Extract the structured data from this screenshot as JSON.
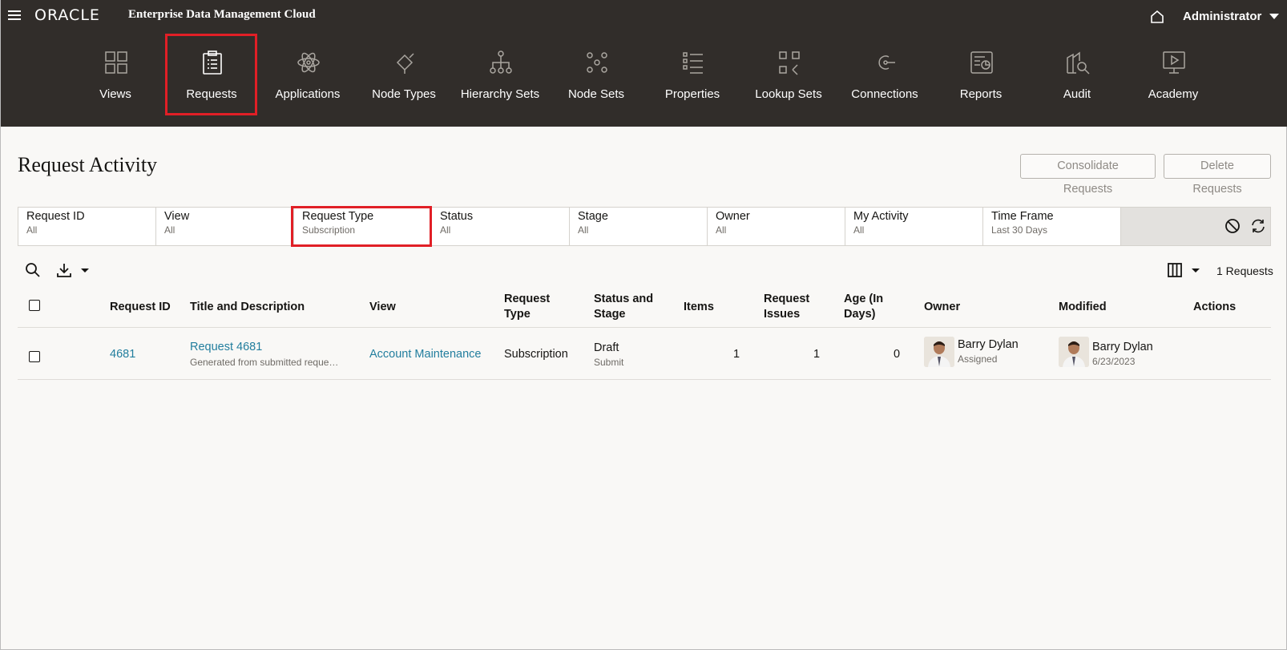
{
  "header": {
    "brand": "ORACLE",
    "app_title": "Enterprise Data Management Cloud",
    "user": "Administrator"
  },
  "nav": [
    {
      "label": "Views",
      "icon": "views-icon"
    },
    {
      "label": "Requests",
      "icon": "clipboard-icon"
    },
    {
      "label": "Applications",
      "icon": "atom-icon"
    },
    {
      "label": "Node Types",
      "icon": "node-type-icon"
    },
    {
      "label": "Hierarchy Sets",
      "icon": "hierarchy-icon"
    },
    {
      "label": "Node Sets",
      "icon": "node-sets-icon"
    },
    {
      "label": "Properties",
      "icon": "list-icon"
    },
    {
      "label": "Lookup Sets",
      "icon": "lookup-icon"
    },
    {
      "label": "Connections",
      "icon": "connection-icon"
    },
    {
      "label": "Reports",
      "icon": "report-icon"
    },
    {
      "label": "Audit",
      "icon": "audit-icon"
    },
    {
      "label": "Academy",
      "icon": "academy-icon"
    }
  ],
  "page": {
    "title": "Request Activity",
    "consolidate_label": "Consolidate Requests",
    "delete_label": "Delete Requests",
    "count": "1 Requests"
  },
  "filters": [
    {
      "label": "Request ID",
      "value": "All"
    },
    {
      "label": "View",
      "value": "All"
    },
    {
      "label": "Request Type",
      "value": "Subscription"
    },
    {
      "label": "Status",
      "value": "All"
    },
    {
      "label": "Stage",
      "value": "All"
    },
    {
      "label": "Owner",
      "value": "All"
    },
    {
      "label": "My Activity",
      "value": "All"
    },
    {
      "label": "Time Frame",
      "value": "Last 30 Days"
    }
  ],
  "table": {
    "headers": {
      "request_id": "Request ID",
      "title": "Title and Description",
      "view": "View",
      "request_type_1": "Request",
      "request_type_2": "Type",
      "status_1": "Status and",
      "status_2": "Stage",
      "items": "Items",
      "issues_1": "Request",
      "issues_2": "Issues",
      "age_1": "Age (In",
      "age_2": "Days)",
      "owner": "Owner",
      "modified": "Modified",
      "actions": "Actions"
    },
    "rows": [
      {
        "id": "4681",
        "title": "Request 4681",
        "description": "Generated from submitted reque…",
        "view": "Account Maintenance",
        "type": "Subscription",
        "status": "Draft",
        "stage": "Submit",
        "items": "1",
        "issues": "1",
        "age": "0",
        "owner": "Barry Dylan",
        "owner_sub": "Assigned",
        "modified_by": "Barry Dylan",
        "modified_date": "6/23/2023"
      }
    ]
  },
  "colors": {
    "header_bg": "#312d2a",
    "highlight": "#e11f26",
    "link": "#227e9e"
  }
}
